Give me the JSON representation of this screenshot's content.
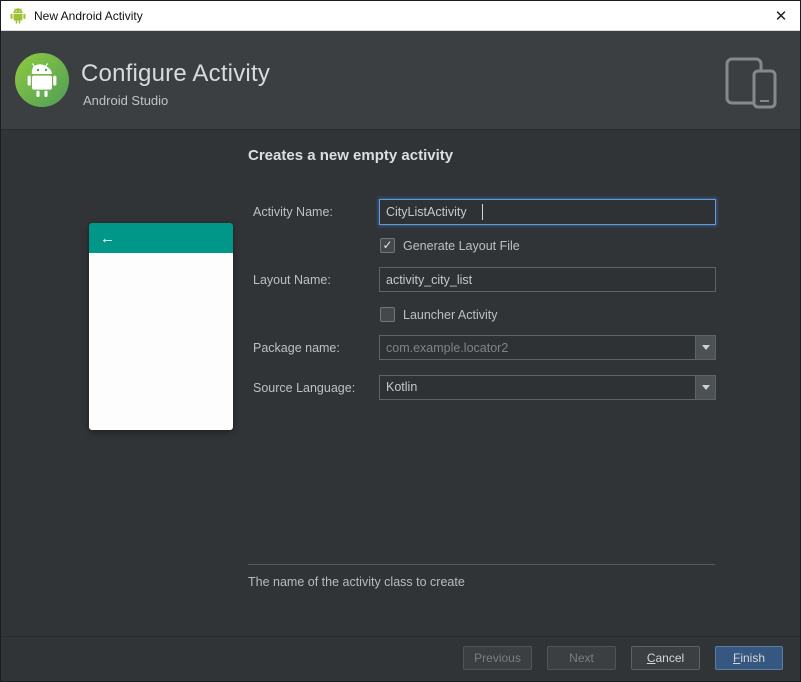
{
  "window": {
    "title": "New Android Activity",
    "close_icon": "✕"
  },
  "header": {
    "title": "Configure Activity",
    "subtitle": "Android Studio"
  },
  "preview": {
    "back_icon": "←"
  },
  "form": {
    "heading": "Creates a new empty activity",
    "activity_name_label": "Activity Name:",
    "activity_name_value": "CityListActivity",
    "generate_layout_label": "Generate Layout File",
    "generate_layout_check": "✓",
    "layout_name_label": "Layout Name:",
    "layout_name_value": "activity_city_list",
    "launcher_label": "Launcher Activity",
    "launcher_check": "",
    "package_label": "Package name:",
    "package_value": "com.example.locator2",
    "language_label": "Source Language:",
    "language_value": "Kotlin",
    "help_text": "The name of the activity class to create"
  },
  "buttons": {
    "previous": "Previous",
    "next": "Next",
    "cancel": "Cancel",
    "finish": "Finish"
  },
  "colors": {
    "accent_teal": "#009688",
    "focus_blue": "#5f9ade",
    "finish_button_blue": "#365880"
  }
}
